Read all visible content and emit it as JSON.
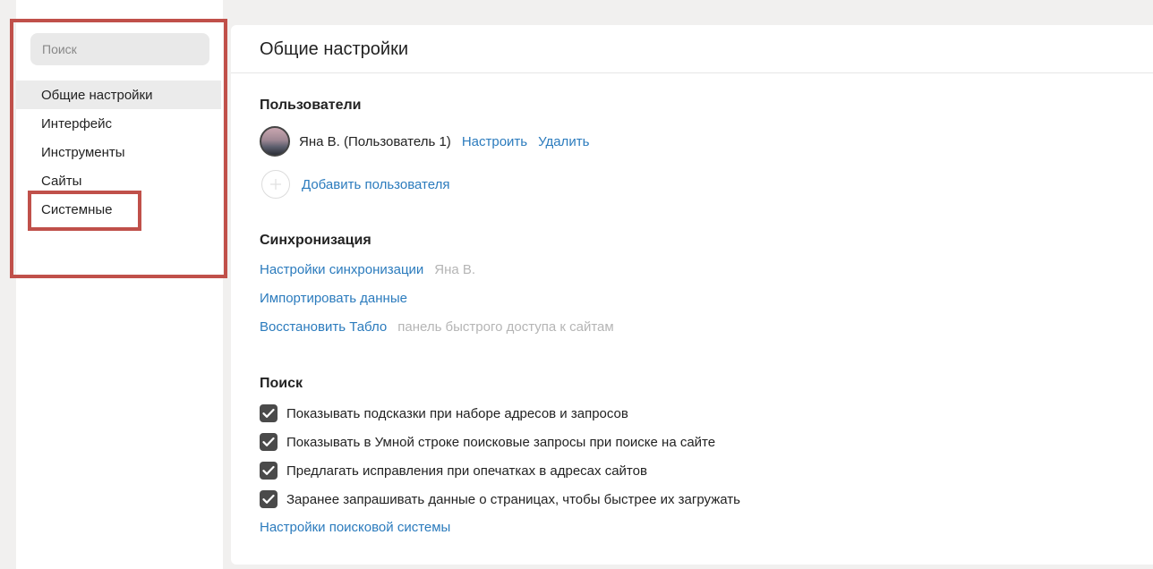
{
  "sidebar": {
    "search_placeholder": "Поиск",
    "items": [
      {
        "label": "Общие настройки"
      },
      {
        "label": "Интерфейс"
      },
      {
        "label": "Инструменты"
      },
      {
        "label": "Сайты"
      },
      {
        "label": "Системные"
      }
    ]
  },
  "panel": {
    "title": "Общие настройки",
    "users": {
      "title": "Пользователи",
      "current_user": "Яна В. (Пользователь 1)",
      "configure_link": "Настроить",
      "delete_link": "Удалить",
      "add_user_link": "Добавить пользователя"
    },
    "sync": {
      "title": "Синхронизация",
      "settings_link": "Настройки синхронизации",
      "settings_hint": "Яна В.",
      "import_link": "Импортировать данные",
      "restore_link": "Восстановить Табло",
      "restore_hint": "панель быстрого доступа к сайтам"
    },
    "search": {
      "title": "Поиск",
      "options": [
        {
          "label": "Показывать подсказки при наборе адресов и запросов",
          "checked": true
        },
        {
          "label": "Показывать в Умной строке поисковые запросы при поиске на сайте",
          "checked": true
        },
        {
          "label": "Предлагать исправления при опечатках в адресах сайтов",
          "checked": true
        },
        {
          "label": "Заранее запрашивать данные о страницах, чтобы быстрее их загружать",
          "checked": true
        }
      ],
      "engine_settings_link": "Настройки поисковой системы"
    }
  },
  "colors": {
    "link": "#2b7bbd",
    "highlight": "#c0504a",
    "checkbox": "#4a4a4a"
  },
  "icons": {
    "avatar": "user-avatar",
    "add": "plus-icon",
    "check": "check-icon"
  }
}
